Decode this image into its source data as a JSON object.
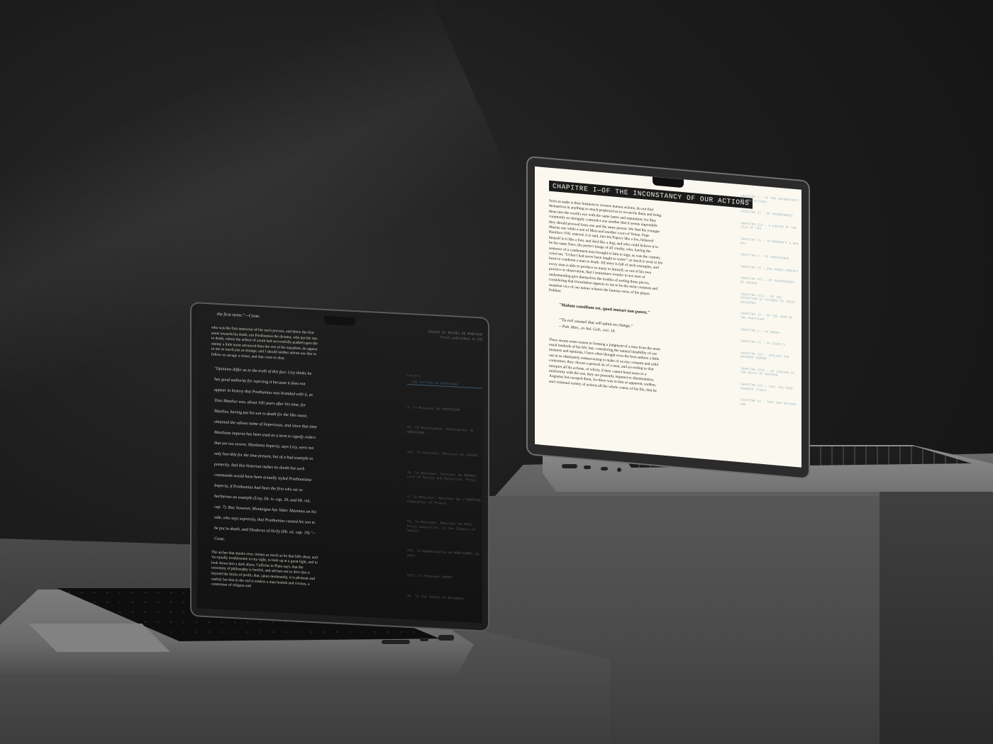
{
  "right_laptop": {
    "title": "CHAPITRE I—OF THE INCONSTANCY OF OUR ACTIONS",
    "paragraph1": "Such as make it their business to oversee human actions, do not find themselves in anything so much perplexed as to reconcile them and bring them into the world's eye with the same lustre and reputation; for they commonly so strangely contradict one another that it seems impossible they should proceed from one and the same person. We find the younger Marius one while a son of Mars and another a son of Venus. Pope Boniface VIII. entered, it is said, into his Papacy like a fox, behaved himself in it like a lion, and died like a dog; and who could believe it to be the same Nero, the perfect image of all cruelty, who, having the sentence of a condemned man brought to him to sign, as was the custom, cried out, \"O that I had never been taught to write!\" so much it went to his heart to condemn a man to death. All story is full of such examples, and every man is able to produce so many to himself, or out of his own practice or observation, that I sometimes wonder to see men of understanding give themselves the trouble of sorting these pieces, considering that irresolution appears to me to be the most common and manifest vice of our nature witness the famous verse of the player Publius:",
    "quote_latin": "\"Malum consilium est, quod mutari non potest.\"",
    "quote_translation": "\"'Tis evil counsel that will admit no change.\"",
    "quote_cite": "—Pub.  Mim., ex Aul. Gell., xvii. 14.",
    "paragraph2": "There seems some reason in forming a judgment of a man from the most usual methods of his life; but, considering the natural instability of our manners and opinions, I have often thought even the best authors a little out in so obstinately endeavouring to make of us any constant and solid contexture; they choose a general air of a man, and according to that interpret all his actions, of which, if they cannot bend some to a uniformity with the rest, they are presently imputed to dissimulation. Augustus has escaped them, for there was in him so apparent, sudden, and continual variety of actions all the whole course of his life, that he",
    "toc": [
      "CHAPITRE I — OF THE INCONSTANCY OF OUR ACTIONS",
      "CHAPITRE II — OF DRUNKENNESS",
      "CHAPITRE III — A CUSTOM OF THE ISLE OF CEA",
      "CHAPITRE IV — TO-MORROW'S A NEW DAY",
      "CHAPITRE V — OF CONSCIENCE",
      "CHAPITRE VI — USE MAKES PERFECT",
      "CHAPITRE VII — OF RECOMPENSES OF HONOUR",
      "CHAPITRE VIII — OF THE AFFECTION OF FATHERS TO THEIR CHILDREN",
      "CHAPITRE IX — OF THE ARMS OF THE PARTHIANS",
      "CHAPITRE X — OF BOOKS",
      "CHAPITRE XI — OF CRUELTY",
      "CHAPITRE XII — APOLOGY FOR RAIMOND SEBOND",
      "CHAPITRE XIII — OF JUDGING OF THE DEATH OF ANOTHER",
      "CHAPITRE XIV — THAT THE MIND HINDERS ITSELF",
      "CHAPITRE XV — THAT OUR DESIRES ARE"
    ]
  },
  "left_laptop": {
    "top_line": "the first stone.\"—Coste.",
    "paragraph1": "who was the first instructor of her son's process, and threw the first stone towards his death, nor Posthumius the dictator, who put his son to death, whom the ardour of youth had successfully pushed upon the enemy a little more advanced than the rest of his squadron, do appear to me so much just as strange; and I should neither advise nor like to follow so savage a virtue, and that costs so dear.",
    "italic_block": "\"Opinions differ as to the truth of this fact.  Livy thinks he has good authority for rejecting it because it does not appear in history that Posthumius was branded with it, as Titus Manlius was, about 100 years after his time; for Manlius, having put his son to death for the like cause, obtained the odious name of Imperiosus, and since that time Manliana imperia has been used as a term to signify orders that are too severe; Manliana Imperia, says Livy, were not only horrible for the time present, but of a bad example to posterity.  And this historian makes no doubt but such commands would have been actually styled Posthumiana Imperia, if Posthumius had been the first who set so barbarous an example (Livy, lib. iv. cap. 29, and lib. viii. cap. 7).  But, however, Montaigne has Valer. Maximus on his side, who says expressly, that Posthumius caused his son to be put to death, and Diodorus of Sicily (lib.  xii.  cap. 19).\"—Coste.",
    "paragraph2": "The archer that shoots over, misses as much as he that falls short, and 'tis equally troublesome to my sight, to look up at a great light, and to look down into a dark abyss. Callicles in Plato says, that the extremity of philosophy is hurtful, and advises not to dive into it beyond the limits of profit; that, taken moderately, it is pleasant and useful; but that in the end it renders a man brutish and vicious, a contemner of religion and",
    "header": "ESSAYS BY MICHEL DE MONTAIGNE",
    "subheader": "first published in 1580",
    "link_label": "Letters",
    "link_active": "THE LETTERS OF MONTAIGNE",
    "items": [
      "I.  To Monsieur de MONTAIGNE",
      "II.  To Monseigneur, Monseigneur de MONTAIGNE",
      "III.  To Monsieur, Monsieur de LANSAC,",
      "IV.  To Monsieur, Monsieur de MESMES, Lord of Roissy and Malassize, Privy",
      "V.  To Monsieur, Monsieur de L'HOSPITAL, Chancellor of France",
      "VI.  To Monsieur, Monsieur de FOIX, Privy Councillor, to the Signory of Venice",
      "VII.  To Mademoiselle de MONTAIGNE, my wife.",
      "VIII.  To Monsieur DUPUY",
      "IX.  To the Jurats of Bordeaux"
    ]
  }
}
